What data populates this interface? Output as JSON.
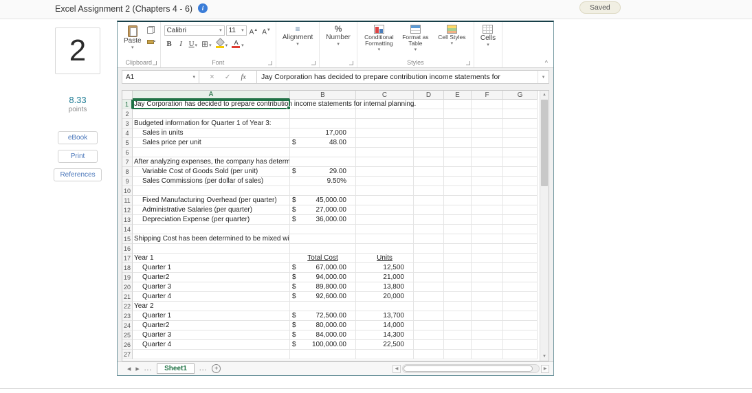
{
  "header": {
    "title": "Excel Assignment 2 (Chapters 4 - 6)",
    "saved": "Saved"
  },
  "sidebar": {
    "question_number": "2",
    "points_value": "8.33",
    "points_label": "points",
    "buttons": [
      {
        "label": "eBook"
      },
      {
        "label": "Print"
      },
      {
        "label": "References"
      }
    ]
  },
  "ribbon": {
    "paste_label": "Paste",
    "group_clipboard": "Clipboard",
    "font_name": "Calibri",
    "font_size": "11",
    "bold_label": "B",
    "italic_label": "I",
    "underline_label": "U",
    "group_font": "Font",
    "alignment_label": "Alignment",
    "number_label": "Number",
    "conditional_formatting_label": "Conditional Formatting",
    "format_as_table_label": "Format as Table",
    "cell_styles_label": "Cell Styles",
    "group_styles": "Styles",
    "cells_label": "Cells"
  },
  "formula_bar": {
    "name_box": "A1",
    "formula": "Jay Corporation  has decided to prepare contribution income statements for"
  },
  "sheet": {
    "active_cell": "A1",
    "columns": [
      "A",
      "B",
      "C",
      "D",
      "E",
      "F",
      "G"
    ],
    "rows": [
      {
        "a": "Jay Corporation  has decided to prepare contribution income statements for internal planning.",
        "overflow": true
      },
      {},
      {
        "a": "Budgeted information for Quarter 1 of Year 3:"
      },
      {
        "a": "Sales in units",
        "ind": 1,
        "b": "17,000"
      },
      {
        "a": "Sales price per unit",
        "ind": 1,
        "sym": "$",
        "b": "48.00"
      },
      {},
      {
        "a": "After analyzing expenses, the company has determined the following cost patterns."
      },
      {
        "a": "Variable Cost of Goods Sold (per unit)",
        "ind": 1,
        "sym": "$",
        "b": "29.00"
      },
      {
        "a": "Sales Commissions (per dollar of sales)",
        "ind": 1,
        "b": "9.50%"
      },
      {},
      {
        "a": "Fixed Manufacturing Overhead (per quarter)",
        "ind": 1,
        "sym": "$",
        "b": "45,000.00"
      },
      {
        "a": "Administrative Salaries (per quarter)",
        "ind": 1,
        "sym": "$",
        "b": "27,000.00"
      },
      {
        "a": "Depreciation Expense (per quarter)",
        "ind": 1,
        "sym": "$",
        "b": "36,000.00"
      },
      {},
      {
        "a": "Shipping Cost has been determined to be mixed with the following costs for the past two years:"
      },
      {},
      {
        "a": "Year 1",
        "b": "Total Cost",
        "c": "Units",
        "hdr": true
      },
      {
        "a": "Quarter 1",
        "ind": 1,
        "sym": "$",
        "b": "67,000.00",
        "c": "12,500"
      },
      {
        "a": "Quarter2",
        "ind": 1,
        "sym": "$",
        "b": "94,000.00",
        "c": "21,000"
      },
      {
        "a": "Quarter 3",
        "ind": 1,
        "sym": "$",
        "b": "89,800.00",
        "c": "13,800"
      },
      {
        "a": "Quarter 4",
        "ind": 1,
        "sym": "$",
        "b": "92,600.00",
        "c": "20,000"
      },
      {
        "a": "Year 2"
      },
      {
        "a": "Quarter 1",
        "ind": 1,
        "sym": "$",
        "b": "72,500.00",
        "c": "13,700"
      },
      {
        "a": "Quarter2",
        "ind": 1,
        "sym": "$",
        "b": "80,000.00",
        "c": "14,000"
      },
      {
        "a": "Quarter 3",
        "ind": 1,
        "sym": "$",
        "b": "84,000.00",
        "c": "14,300"
      },
      {
        "a": "Quarter 4",
        "ind": 1,
        "sym": "$",
        "b": "100,000.00",
        "c": "22,500"
      },
      {}
    ],
    "tabs": {
      "sheet1": "Sheet1",
      "ellipsis": "...",
      "add": "+"
    }
  },
  "icons": {
    "info": "i",
    "dropdown": "▾",
    "collapse": "^",
    "up_arrow": "▲",
    "down_arrow": "▼",
    "left_arrow": "◀",
    "right_arrow": "▶",
    "cancel": "×",
    "enter": "✓",
    "fx": "fx",
    "align": "≡",
    "percent": "%",
    "borders": "⊞",
    "font_letter": "A"
  }
}
